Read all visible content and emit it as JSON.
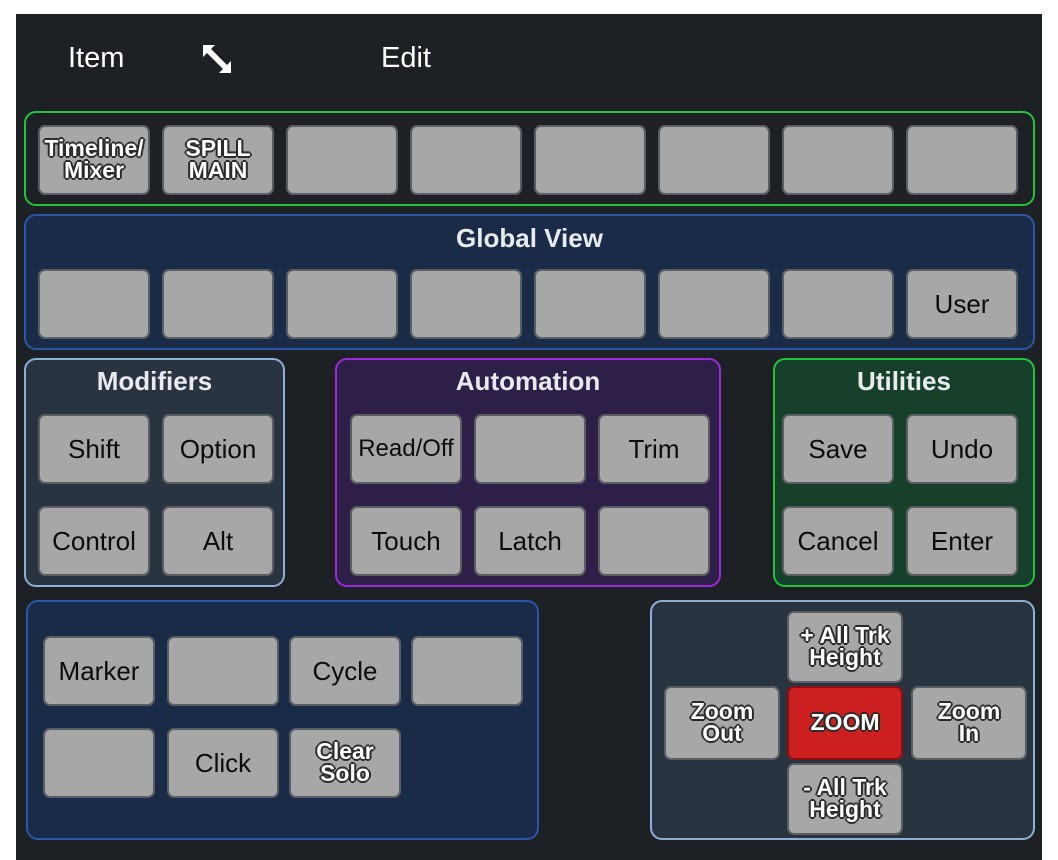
{
  "header": {
    "item_label": "Item",
    "edit_label": "Edit",
    "expand_icon": "expand-diagonal-icon"
  },
  "top_row": {
    "buttons": [
      "Timeline/\nMixer",
      "SPILL\nMAIN",
      "",
      "",
      "",
      "",
      "",
      ""
    ],
    "accent": "#22c33a"
  },
  "global_view": {
    "title": "Global View",
    "buttons": [
      "",
      "",
      "",
      "",
      "",
      "",
      "",
      "User"
    ],
    "accent": "#2b57a8"
  },
  "modifiers": {
    "title": "Modifiers",
    "buttons": [
      "Shift",
      "Option",
      "Control",
      "Alt"
    ],
    "accent": "#8fb0d6"
  },
  "automation": {
    "title": "Automation",
    "buttons": [
      "Read/Off",
      "",
      "Trim",
      "Touch",
      "Latch",
      ""
    ],
    "accent": "#9a2ad8"
  },
  "utilities": {
    "title": "Utilities",
    "buttons": [
      "Save",
      "Undo",
      "Cancel",
      "Enter"
    ],
    "accent": "#22c33a"
  },
  "transport": {
    "buttons": [
      "Marker",
      "",
      "Cycle",
      "",
      "",
      "Click",
      "Clear\nSolo"
    ],
    "accent": "#2b57a8"
  },
  "zoom": {
    "plus_height": "+ All Trk\nHeight",
    "zoom_out": "Zoom\nOut",
    "zoom": "ZOOM",
    "zoom_in": "Zoom\nIn",
    "minus_height": "- All Trk\nHeight",
    "zoom_color": "#cc2020",
    "accent": "#8fb0d6"
  }
}
